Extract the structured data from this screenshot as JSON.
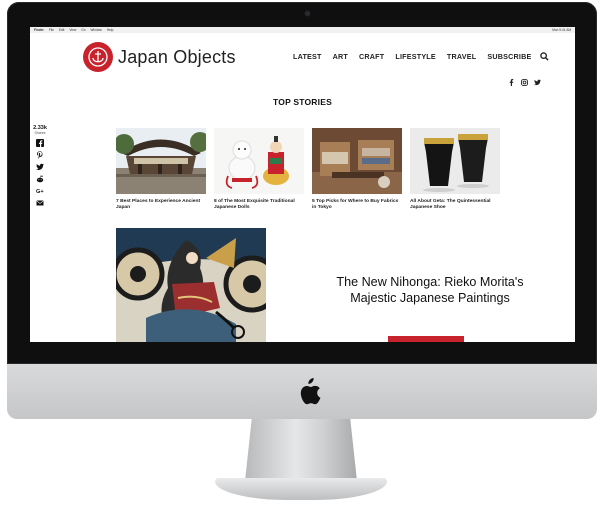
{
  "menubar": {
    "items": [
      "Finder",
      "File",
      "Edit",
      "View",
      "Go",
      "Window",
      "Help"
    ],
    "right": "Mon 9:41 AM"
  },
  "site": {
    "logo_text": "Japan Objects",
    "nav": [
      "LATEST",
      "ART",
      "CRAFT",
      "LIFESTYLE",
      "TRAVEL",
      "SUBSCRIBE"
    ],
    "section_title": "TOP STORIES"
  },
  "share": {
    "count": "2.33k",
    "label": "Shares"
  },
  "stories": [
    {
      "title": "7 Best Places to Experience Ancient Japan"
    },
    {
      "title": "8 of The Most Exquisite Traditional Japanese Dolls"
    },
    {
      "title": "5 Top Picks for Where to Buy Fabrics in Tokyo"
    },
    {
      "title": "All About Geta: The Quintessential Japanese Shoe"
    }
  ],
  "feature": {
    "title": "The New Nihonga: Rieko Morita's Majestic Japanese Paintings"
  },
  "colors": {
    "brand_red": "#c8232c",
    "text": "#222222"
  }
}
